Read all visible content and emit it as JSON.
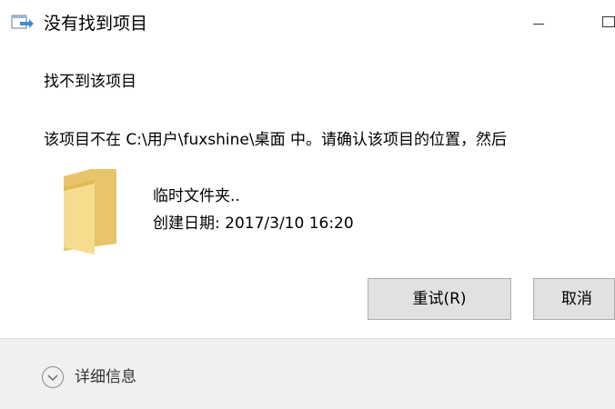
{
  "window": {
    "title": "没有找到项目"
  },
  "dialog": {
    "heading": "找不到该项目",
    "message": "该项目不在 C:\\用户\\fuxshine\\桌面 中。请确认该项目的位置，然后",
    "item": {
      "name": "临时文件夹..",
      "date": "创建日期: 2017/3/10 16:20",
      "icon": "folder-icon"
    }
  },
  "buttons": {
    "retry": "重试(R)",
    "cancel": "取消"
  },
  "footer": {
    "details_label": "详细信息",
    "icon": "chevron-down-icon"
  },
  "colors": {
    "folder_body": "#f2d27c",
    "folder_front": "#f8e19a",
    "button_bg": "#e1e1e1",
    "footer_bg": "#f0f0f0"
  }
}
